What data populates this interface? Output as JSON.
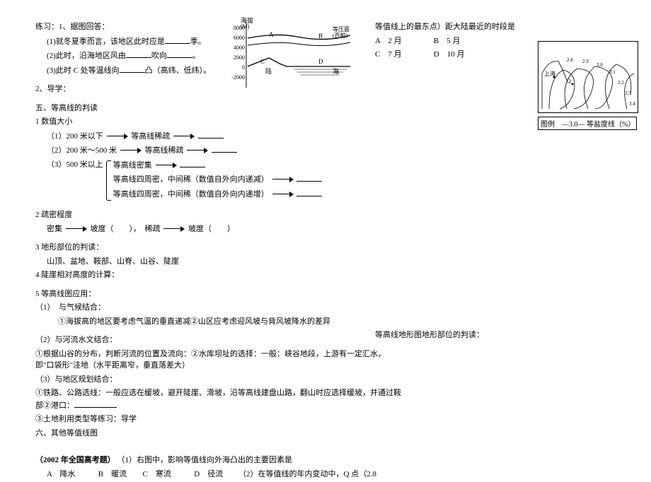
{
  "left": {
    "ex_title": "练习：1、据图回答：",
    "q1": "(1)就冬夏季而言，该地区此时应是",
    "q1_suffix": "季。",
    "q2a": "(2)此时，沿海地区风由",
    "q2b": "吹向",
    "q2c": "。",
    "q3a": "(3)此时 C 处等温线向",
    "q3b": "凸（高纬、低纬）。",
    "daoxue": "2、导学：",
    "sec5_title": "五、等高线的判读",
    "item1_title": "1 数值大小",
    "item1_1a": "（1）200 米以下",
    "item1_1b": "等高线稀疏",
    "item1_2a": "（2）200 米～500 米",
    "item1_2b": "等高线稀疏",
    "item1_3a": "（3）500 米以上",
    "item1_3b": "等高线密集",
    "item1_3c": "等高线四周密，中间稀（数值自外向内递减）",
    "item1_3d": "等高线四周密，中间稀（数值自外向内递增）",
    "item2_title": "2 疏密程度",
    "item2_a": "密集",
    "item2_b": "坡度（　　），　稀疏",
    "item2_c": "坡度（　　）",
    "item3_title": "3 地形部位的判读：",
    "item3_body": "山顶、盆地、鞍部、山脊、山谷、陡崖",
    "item4": "4 陡崖相对高度的计算：",
    "item5_title": "5 等高线图应用：",
    "item5_1": "（1）　与气候结合：",
    "item5_1body": "①海拔高的地区要考虑气温的垂直递减②山区应考虑迎风坡与背风坡降水的差异",
    "item5_2": "（2）与河流水文结合：",
    "item5_2body": "①根据山谷的分布，判断河流的位置及流向：②水库坝址的选择：一般：峡谷地段，上游有一定汇水，即\"口袋形\"洼地（水平距离窄，垂直落差大）",
    "item5_3": "（3）与地区规划结合：",
    "item5_3a": "①铁路、公路选线：一般应选在缓坡，避开陡崖、滑坡，沿等高线建盘山路，翻山时应选择缓坡，并通过鞍部②港口：",
    "item5_3b": "③土地利用类型等练习：导学",
    "sec6": "六、其他等值线图",
    "exam_title": "（2002 年全国高考题）",
    "exam_body": "（1）右图中，影响等值线向外海凸出的主要因素是",
    "exam_opts_a": "A　降水",
    "exam_opts_b": "B　暖流",
    "exam_opts_c": "C　寒流",
    "exam_opts_d": "D　径流",
    "exam_q2": "（2）在等值线的年内变动中，Q 点（2.8"
  },
  "right": {
    "continuation": "等值线上的最东点）距大陆最近的时段是",
    "opt_a": "A　2 月",
    "opt_b": "B　5 月",
    "opt_c": "C　7 月",
    "opt_d": "D　10 月",
    "side_note": "等高线地形图地形部位的判读：",
    "legend": "图例　—3.0— 等盐度线（%）"
  },
  "chart_data": [
    {
      "type": "diagram",
      "title": "海拔(M)",
      "ylabel": "海拔",
      "y_ticks": [
        8000,
        6000,
        4000,
        2000,
        0,
        -2000
      ],
      "labels": [
        "A",
        "B",
        "C",
        "D",
        "陆",
        "海",
        "等压面(百帕)"
      ]
    },
    {
      "type": "map",
      "title": "等盐度线",
      "labels": [
        "上海",
        "Q"
      ],
      "contours": [
        2.8,
        2.9,
        3.0,
        3.1,
        3.2,
        3.3,
        3.4
      ],
      "legend": "—3.0— 等盐度线（%）"
    }
  ]
}
